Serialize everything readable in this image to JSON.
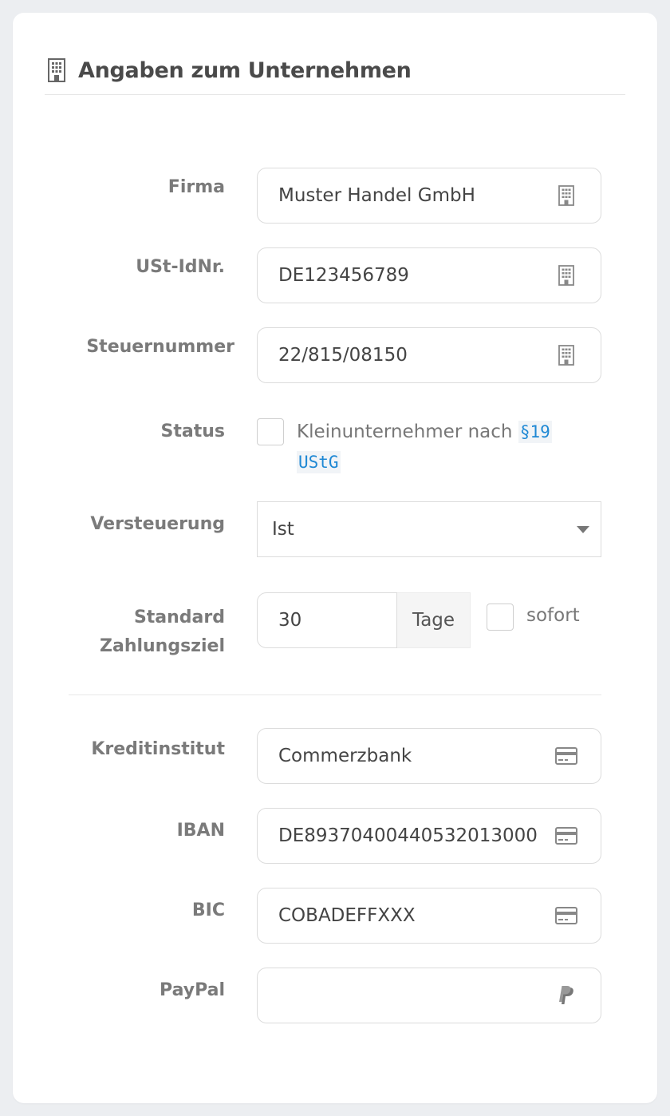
{
  "header": {
    "title": "Angaben zum Unternehmen",
    "icon": "building-icon"
  },
  "company": {
    "firma": {
      "label": "Firma",
      "value": "Muster Handel GmbH",
      "icon": "building-icon"
    },
    "ustid": {
      "label": "USt-IdNr.",
      "value": "DE123456789",
      "icon": "building-icon"
    },
    "steuernummer": {
      "label": "Steuernummer",
      "value": "22/815/08150",
      "icon": "building-icon"
    },
    "status": {
      "label": "Status",
      "text": "Kleinunternehmer nach",
      "code_part1": "§19",
      "code_part2": "UStG",
      "checked": false
    },
    "versteuerung": {
      "label": "Versteuerung",
      "selected": "Ist"
    },
    "zahlungsziel": {
      "label_line1": "Standard",
      "label_line2": "Zahlungsziel",
      "value": "30",
      "unit": "Tage",
      "sofort_label": "sofort",
      "sofort_checked": false
    }
  },
  "bank": {
    "kreditinstitut": {
      "label": "Kreditinstitut",
      "value": "Commerzbank",
      "icon": "credit-card-icon"
    },
    "iban": {
      "label": "IBAN",
      "value": "DE89370400440532013000",
      "icon": "credit-card-icon"
    },
    "bic": {
      "label": "BIC",
      "value": "COBADEFFXXX",
      "icon": "credit-card-icon"
    },
    "paypal": {
      "label": "PayPal",
      "value": "",
      "icon": "paypal-icon"
    }
  },
  "colors": {
    "accent_code": "#1e88d4",
    "label": "#7a7a7a",
    "border": "#dcdcdc"
  }
}
